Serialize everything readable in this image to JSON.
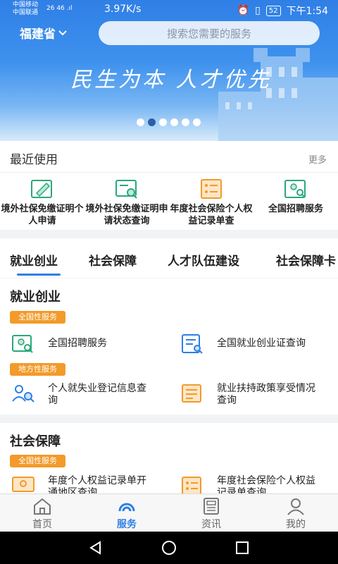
{
  "status_bar": {
    "carrier1": "中国移动",
    "carrier2": "中国联通",
    "signal": "26 46 .ıl",
    "speed": "3.97K/s",
    "battery": "52",
    "time": "下午1:54"
  },
  "header": {
    "province": "福建省",
    "search_placeholder": "搜索您需要的服务",
    "slogan": "民生为本 人才优先"
  },
  "recent": {
    "title": "最近使用",
    "more": "更多",
    "items": [
      {
        "label": "境外社保免缴证明个人申请",
        "icon": "edit-doc-icon",
        "color": "#2aa87a"
      },
      {
        "label": "境外社保免缴证明申请状态查询",
        "icon": "search-doc-icon",
        "color": "#2aa87a"
      },
      {
        "label": "年度社会保险个人权益记录单查",
        "icon": "checklist-icon",
        "color": "#f39a2a"
      },
      {
        "label": "全国招聘服务",
        "icon": "person-search-icon",
        "color": "#2aa87a"
      }
    ]
  },
  "tabs": [
    "就业创业",
    "社会保障",
    "人才队伍建设",
    "社会保障卡"
  ],
  "sections": [
    {
      "title": "就业创业",
      "groups": [
        {
          "badge": "全国性服务",
          "items": [
            {
              "label": "全国招聘服务",
              "icon": "person-search-icon",
              "color": "#2aa87a"
            },
            {
              "label": "全国就业创业证查询",
              "icon": "doc-search-icon",
              "color": "#2e7fe5"
            }
          ]
        },
        {
          "badge": "地方性服务",
          "items": [
            {
              "label": "个人就失业登记信息查询",
              "icon": "people-search-icon",
              "color": "#2e7fe5"
            },
            {
              "label": "就业扶持政策享受情况查询",
              "icon": "doc-list-icon",
              "color": "#f39a2a"
            }
          ]
        }
      ]
    },
    {
      "title": "社会保障",
      "groups": [
        {
          "badge": "全国性服务",
          "items": [
            {
              "label": "年度个人权益记录单开通地区查询",
              "icon": "monitor-icon",
              "color": "#f39a2a"
            },
            {
              "label": "年度社会保险个人权益记录单查询",
              "icon": "checklist-icon",
              "color": "#f39a2a"
            }
          ]
        }
      ]
    }
  ],
  "bottom_nav": [
    {
      "label": "首页",
      "icon": "home-icon",
      "active": false
    },
    {
      "label": "服务",
      "icon": "service-icon",
      "active": true
    },
    {
      "label": "资讯",
      "icon": "news-icon",
      "active": false
    },
    {
      "label": "我的",
      "icon": "user-icon",
      "active": false
    }
  ],
  "colors": {
    "accent": "#2e7fe5",
    "badge": "#f39a2a",
    "green": "#2aa87a"
  }
}
